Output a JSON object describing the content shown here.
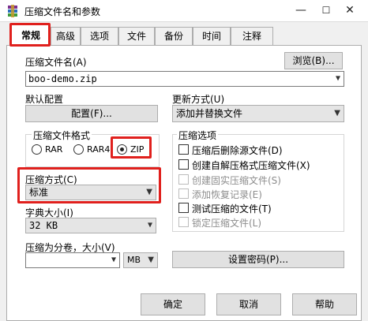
{
  "window": {
    "title": "压缩文件名和参数",
    "minimize": "—",
    "maximize": "☐",
    "close": "✕"
  },
  "tabs": [
    {
      "label": "常规"
    },
    {
      "label": "高级"
    },
    {
      "label": "选项"
    },
    {
      "label": "文件"
    },
    {
      "label": "备份"
    },
    {
      "label": "时间"
    },
    {
      "label": "注释"
    }
  ],
  "archive_name": {
    "label": "压缩文件名(A)",
    "value": "boo-demo.zip",
    "browse": "浏览(B)..."
  },
  "default_config": {
    "label": "默认配置",
    "button": "配置(F)..."
  },
  "update_mode": {
    "label": "更新方式(U)",
    "value": "添加并替换文件"
  },
  "format": {
    "title": "压缩文件格式",
    "options": [
      "RAR",
      "RAR4",
      "ZIP"
    ],
    "selected": "ZIP"
  },
  "method": {
    "label": "压缩方式(C)",
    "value": "标准"
  },
  "dictionary": {
    "label": "字典大小(I)",
    "value": "32 KB"
  },
  "split": {
    "label": "压缩为分卷，大小(V)",
    "value": "",
    "unit": "MB"
  },
  "options": {
    "title": "压缩选项",
    "items": [
      {
        "label": "压缩后删除源文件(D)",
        "checked": false,
        "enabled": true
      },
      {
        "label": "创建自解压格式压缩文件(X)",
        "checked": false,
        "enabled": true
      },
      {
        "label": "创建固实压缩文件(S)",
        "checked": false,
        "enabled": false
      },
      {
        "label": "添加恢复记录(E)",
        "checked": false,
        "enabled": false
      },
      {
        "label": "测试压缩的文件(T)",
        "checked": false,
        "enabled": true
      },
      {
        "label": "锁定压缩文件(L)",
        "checked": false,
        "enabled": false
      }
    ]
  },
  "password_button": "设置密码(P)...",
  "footer": {
    "ok": "确定",
    "cancel": "取消",
    "help": "帮助"
  },
  "colors": {
    "highlight": "#e0201d"
  }
}
